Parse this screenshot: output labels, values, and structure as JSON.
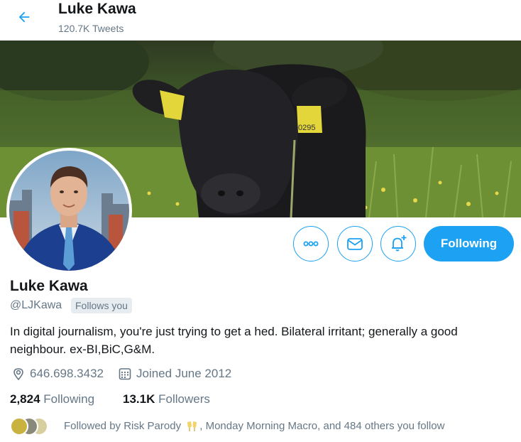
{
  "header": {
    "name": "Luke Kawa",
    "tweet_count": "120.7K Tweets"
  },
  "actions": {
    "follow_label": "Following"
  },
  "profile": {
    "name": "Luke Kawa",
    "handle": "@LJKawa",
    "follows_you": "Follows you",
    "bio": "In digital journalism, you're just trying to get a hed. Bilateral irritant; generally a good neighbour. ex-BI,BiC,G&M.",
    "location": "646.698.3432",
    "joined": "Joined June 2012"
  },
  "stats": {
    "following_count": "2,824",
    "following_label": "Following",
    "followers_count": "13.1K",
    "followers_label": "Followers"
  },
  "followed_by": {
    "prefix": "Followed by Risk Parody",
    "suffix": ", Monday Morning Macro, and 484 others you follow"
  },
  "colors": {
    "accent": "#1da1f2",
    "text_primary": "#14171a",
    "text_secondary": "#657786"
  }
}
